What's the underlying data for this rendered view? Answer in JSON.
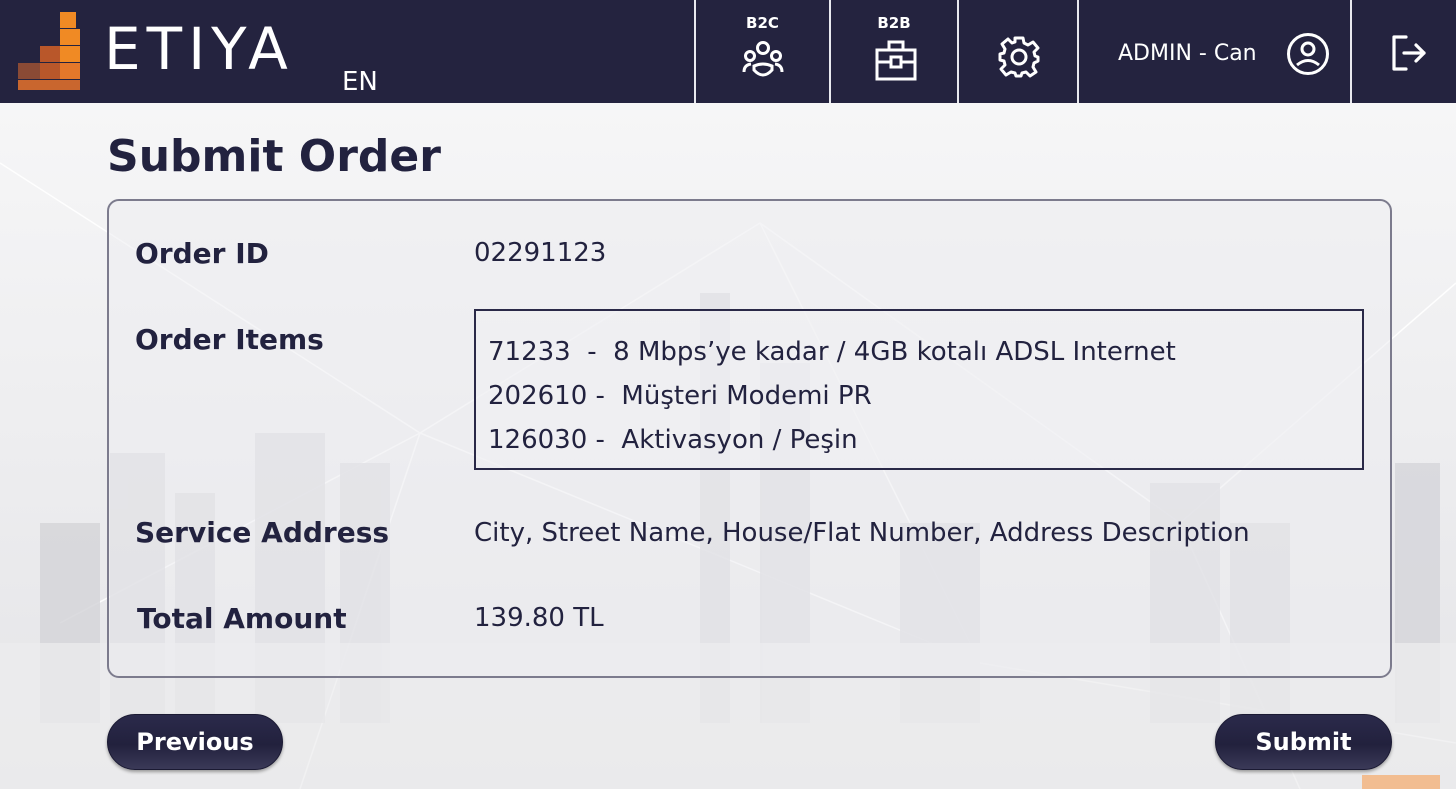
{
  "header": {
    "brand": "ETIYA",
    "language": "EN",
    "nav": {
      "b2c_label": "B2C",
      "b2b_label": "B2B"
    },
    "user_label": "ADMIN - Can",
    "icons": [
      "b2c-people-icon",
      "b2b-briefcase-icon",
      "gear-icon",
      "user-circle-icon",
      "logout-icon"
    ],
    "colors": {
      "header_bg": "#24233f",
      "logo_orange": "#f08a24",
      "logo_dark_orange": "#b9572a"
    }
  },
  "page": {
    "title": "Submit Order"
  },
  "order": {
    "labels": {
      "order_id": "Order ID",
      "order_items": "Order Items",
      "service_address": "Service Address",
      "total_amount": "Total Amount"
    },
    "order_id": "02291123",
    "items": [
      "71233  -  8 Mbps’ye kadar / 4GB kotalı ADSL Internet",
      "202610 -  Müşteri Modemi PR",
      "126030 -  Aktivasyon / Peşin"
    ],
    "service_address": "City, Street Name, House/Flat Number, Address Description",
    "total_amount": "139.80 TL"
  },
  "buttons": {
    "previous": "Previous",
    "submit": "Submit"
  }
}
